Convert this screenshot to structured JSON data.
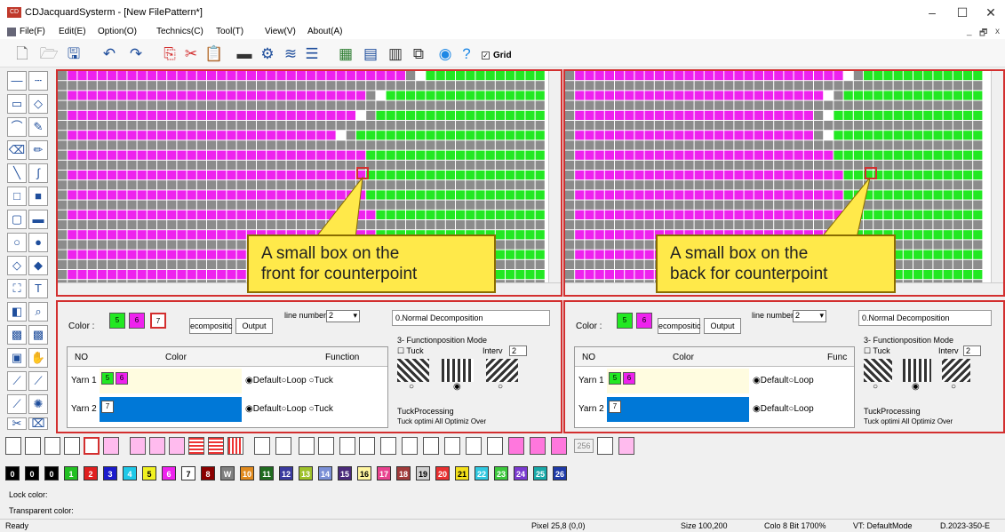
{
  "window": {
    "title": "CDJacquardSysterm - [New FilePattern*]",
    "logo": "CD",
    "minimize": "–",
    "maximize": "☐",
    "close": "✕",
    "child_min": "_",
    "child_restore": "🗗",
    "child_close": "x"
  },
  "menu": [
    "File(F)",
    "Edit(E)",
    "Option(O)",
    "Technics(C)",
    "Tool(T)",
    "View(V)",
    "About(A)"
  ],
  "toolbar": {
    "grid_label": "Grid",
    "grid_checked": true
  },
  "panes": {
    "front_callout": [
      "A small box on the",
      "front for counterpoint"
    ],
    "back_callout": [
      "A small box on the",
      "back for counterpoint"
    ]
  },
  "lower_left": {
    "color_label": "Color :",
    "color_swatches": [
      "5",
      "6",
      "7"
    ],
    "decompose_button": "ecompositic",
    "output_button": "Output",
    "line_numbers_label": "line numbers",
    "line_numbers_value": "2",
    "decomposition_value": "0.Normal Decomposition",
    "function_mode_title": "3- Functionposition Mode",
    "tuck_label": "Tuck",
    "interval_label": "Interv",
    "interval_value": "2",
    "tuck_processing_title": "TuckProcessing",
    "tuck_processing_options": "Tuck optimi  All Optimiz  Over",
    "table_headers": [
      "NO",
      "Color",
      "Function"
    ],
    "rows": [
      {
        "no": "Yarn 1",
        "swatches": [
          "5",
          "6"
        ],
        "options": [
          "Default",
          "Loop",
          "Tuck"
        ]
      },
      {
        "no": "Yarn 2",
        "swatches": [
          "7"
        ],
        "options": [
          "Default",
          "Loop",
          "Tuck"
        ]
      }
    ]
  },
  "lower_right": {
    "color_label": "Color :",
    "color_swatches": [
      "5",
      "6"
    ],
    "decompose_button": "ecompositic",
    "output_button": "Output",
    "line_numbers_label": "line numbers",
    "line_numbers_value": "2",
    "decomposition_value": "0.Normal Decomposition",
    "function_mode_title": "3- Functionposition Mode",
    "tuck_label": "Tuck",
    "interval_label": "Interv",
    "interval_value": "2",
    "tuck_processing_title": "TuckProcessing",
    "tuck_processing_options": "Tuck optimi  All Optimiz  Over",
    "table_headers": [
      "NO",
      "Color",
      "Func"
    ],
    "rows": [
      {
        "no": "Yarn 1",
        "swatches": [
          "5",
          "6"
        ],
        "options": [
          "Default",
          "Loop"
        ]
      },
      {
        "no": "Yarn 2",
        "swatches": [
          "7"
        ],
        "options": [
          "Default",
          "Loop"
        ]
      }
    ]
  },
  "palette": [
    {
      "label": "0",
      "bg": "#000000",
      "fg": "#ffffff"
    },
    {
      "label": "0",
      "bg": "#000000",
      "fg": "#ffffff"
    },
    {
      "label": "0",
      "bg": "#000000",
      "fg": "#ffffff"
    },
    {
      "label": "1",
      "bg": "#22c022",
      "fg": "#ffffff"
    },
    {
      "label": "2",
      "bg": "#e01f1f",
      "fg": "#ffffff"
    },
    {
      "label": "3",
      "bg": "#1a1acc",
      "fg": "#ffffff"
    },
    {
      "label": "4",
      "bg": "#1ec8e8",
      "fg": "#ffffff"
    },
    {
      "label": "5",
      "bg": "#f0f020",
      "fg": "#000000"
    },
    {
      "label": "6",
      "bg": "#ee22ee",
      "fg": "#ffffff"
    },
    {
      "label": "7",
      "bg": "#ffffff",
      "fg": "#000000"
    },
    {
      "label": "8",
      "bg": "#8b0000",
      "fg": "#ffffff"
    },
    {
      "label": "W",
      "bg": "#808080",
      "fg": "#ffffff"
    },
    {
      "label": "10",
      "bg": "#e08a1e",
      "fg": "#ffffff"
    },
    {
      "label": "11",
      "bg": "#1f6b1f",
      "fg": "#ffffff"
    },
    {
      "label": "12",
      "bg": "#3a3a9e",
      "fg": "#ffffff"
    },
    {
      "label": "13",
      "bg": "#9ec12a",
      "fg": "#ffffff"
    },
    {
      "label": "14",
      "bg": "#7a8fd6",
      "fg": "#ffffff"
    },
    {
      "label": "15",
      "bg": "#4a2a7a",
      "fg": "#ffffff"
    },
    {
      "label": "16",
      "bg": "#fff5a0",
      "fg": "#000000"
    },
    {
      "label": "17",
      "bg": "#e8428e",
      "fg": "#ffffff"
    },
    {
      "label": "18",
      "bg": "#a03a3a",
      "fg": "#ffffff"
    },
    {
      "label": "19",
      "bg": "#d0d0d0",
      "fg": "#000000"
    },
    {
      "label": "20",
      "bg": "#e83030",
      "fg": "#ffffff"
    },
    {
      "label": "21",
      "bg": "#f4e01a",
      "fg": "#000000"
    },
    {
      "label": "22",
      "bg": "#30c8e0",
      "fg": "#ffffff"
    },
    {
      "label": "23",
      "bg": "#3cc83c",
      "fg": "#ffffff"
    },
    {
      "label": "24",
      "bg": "#7a3ad0",
      "fg": "#ffffff"
    },
    {
      "label": "25",
      "bg": "#18a8a8",
      "fg": "#ffffff"
    },
    {
      "label": "26",
      "bg": "#1e3aa8",
      "fg": "#ffffff"
    }
  ],
  "lock_color_label": "Lock color:",
  "transparent_color_label": "Transparent color:",
  "bottom_tools_badge": "256",
  "status": {
    "ready": "Ready",
    "pixel": "Pixel  25,8  (0,0)",
    "size": "Size  100,200",
    "color": "Colo  8 Bit  1700%",
    "vt": "VT: DefaultMode",
    "version": "D.2023-350-E"
  },
  "colors": {
    "magenta": "#ee22ee",
    "green": "#22e822",
    "gray": "#8c8c8c",
    "red_border": "#d32f2f",
    "callout": "#ffe94a"
  }
}
